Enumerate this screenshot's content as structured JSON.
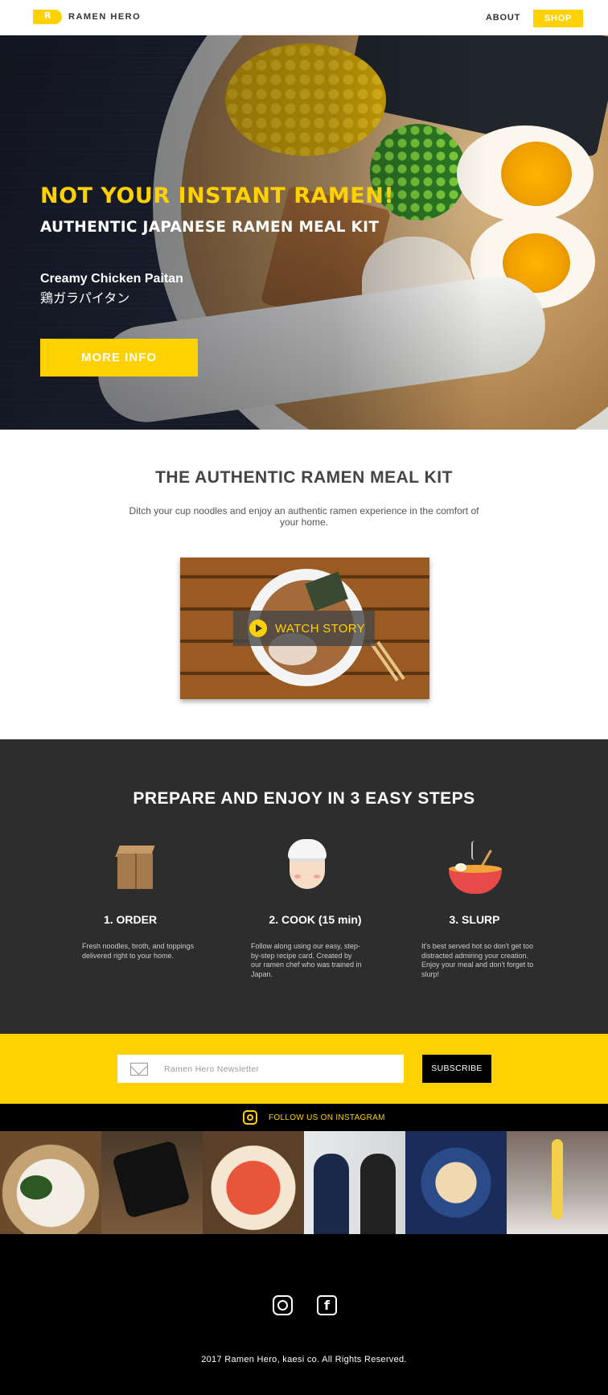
{
  "header": {
    "logo_text": "RAMEN HERO",
    "nav": {
      "about": "ABOUT",
      "shop": "SHOP"
    }
  },
  "hero": {
    "title": "NOT YOUR INSTANT RAMEN!",
    "subtitle": "AUTHENTIC JAPANESE RAMEN MEAL KIT",
    "flavor_en": "Creamy Chicken Paitan",
    "flavor_jp": "鶏ガラパイタン",
    "cta": "MORE INFO"
  },
  "about": {
    "title": "THE AUTHENTIC RAMEN MEAL KIT",
    "description": "Ditch your cup noodles and enjoy an authentic ramen experience in the comfort of your home.",
    "video_cta": "WATCH STORY"
  },
  "steps": {
    "title": "PREPARE AND ENJOY IN 3 EASY STEPS",
    "items": [
      {
        "title": "1. ORDER",
        "description": "Fresh noodles, broth, and toppings delivered right to your home.",
        "icon": "box-icon"
      },
      {
        "title": "2. COOK (15 min)",
        "description": "Follow along using our easy, step-by-step recipe card. Created by our ramen chef who was trained in Japan.",
        "icon": "chef-icon"
      },
      {
        "title": "3. SLURP",
        "description": "It's best served hot so don't get too distracted admiring your creation. Enjoy your meal and don't forget to slurp!",
        "icon": "ramen-bowl-icon"
      }
    ]
  },
  "newsletter": {
    "placeholder": "Ramen Hero Newsletter",
    "button": "SUBSCRIBE"
  },
  "instagram": {
    "label": "FOLLOW US ON INSTAGRAM",
    "photos": [
      "ramen-bowl-photo",
      "cap-photo",
      "spicy-ramen-photo",
      "founders-photo",
      "egg-ramen-photo",
      "noodle-lift-photo"
    ]
  },
  "footer": {
    "copyright": "2017 Ramen Hero, kaesi co. All Rights Reserved.",
    "social": [
      "instagram-icon",
      "facebook-icon"
    ]
  },
  "colors": {
    "accent": "#FFD100",
    "dark_section": "#2D2D2D",
    "footer": "#000000"
  }
}
